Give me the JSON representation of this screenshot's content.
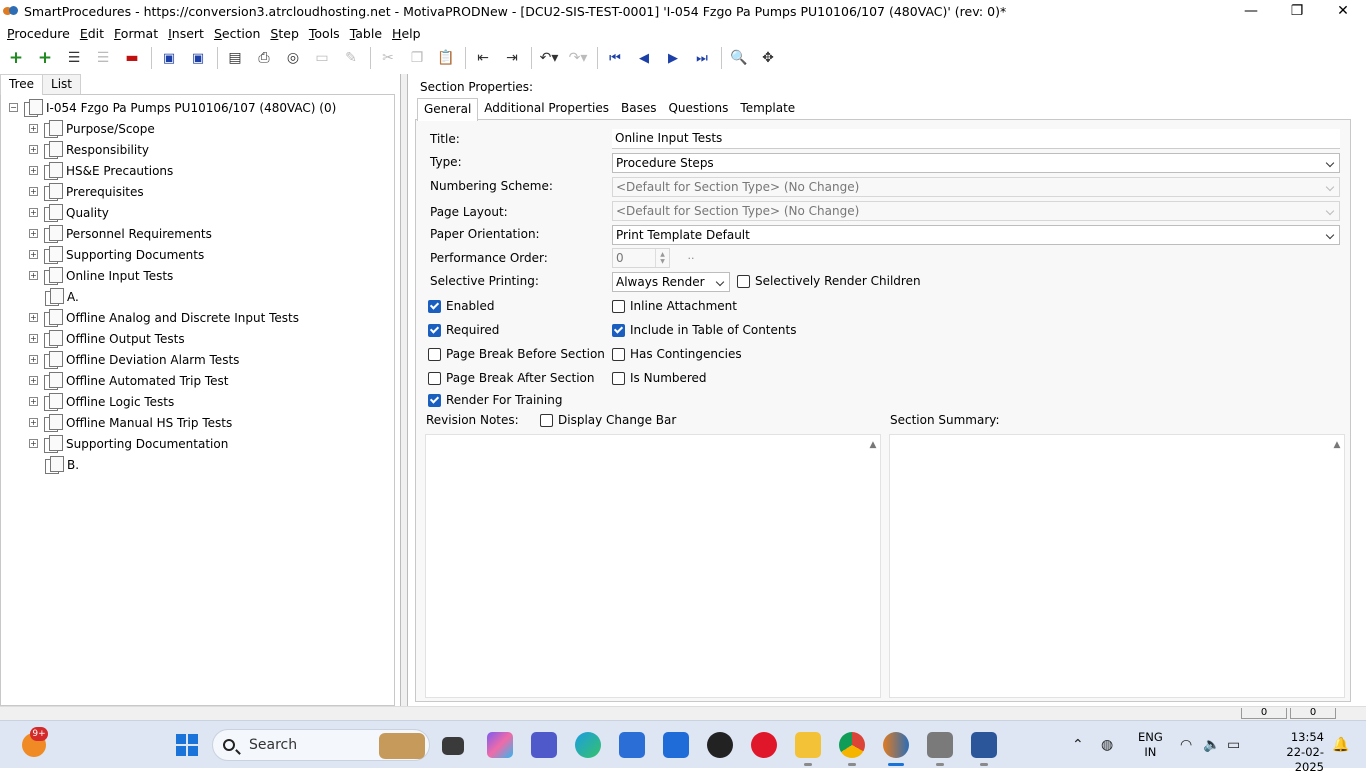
{
  "window": {
    "title": "SmartProcedures - https://conversion3.atrcloudhosting.net - MotivaPRODNew - [DCU2-SIS-TEST-0001] 'I-054 Fzgo Pa Pumps PU10106/107 (480VAC)' (rev: 0)*",
    "minimize": "—",
    "maximize": "❐",
    "close": "✕"
  },
  "menu": [
    "Procedure",
    "Edit",
    "Format",
    "Insert",
    "Section",
    "Step",
    "Tools",
    "Table",
    "Help"
  ],
  "left_pane": {
    "tabs": [
      "Tree",
      "List"
    ],
    "active_tab": "Tree",
    "root": {
      "label": "I-054 Fzgo Pa Pumps PU10106/107 (480VAC) (0)",
      "expander": "−"
    },
    "nodes": [
      {
        "label": "Purpose/Scope",
        "expander": "+"
      },
      {
        "label": "Responsibility",
        "expander": "+"
      },
      {
        "label": "HS&E Precautions",
        "expander": "+"
      },
      {
        "label": "Prerequisites",
        "expander": "+"
      },
      {
        "label": "Quality",
        "expander": "+"
      },
      {
        "label": "Personnel Requirements",
        "expander": "+"
      },
      {
        "label": "Supporting Documents",
        "expander": "+"
      },
      {
        "label": "Online Input Tests",
        "expander": "+"
      },
      {
        "label": "A.",
        "expander": ""
      },
      {
        "label": "Offline Analog and Discrete Input Tests",
        "expander": "+"
      },
      {
        "label": "Offline Output Tests",
        "expander": "+"
      },
      {
        "label": "Offline Deviation Alarm Tests",
        "expander": "+"
      },
      {
        "label": "Offline Automated Trip Test",
        "expander": "+"
      },
      {
        "label": "Offline Logic Tests",
        "expander": "+"
      },
      {
        "label": "Offline Manual HS Trip Tests",
        "expander": "+"
      },
      {
        "label": "Supporting Documentation",
        "expander": "+"
      },
      {
        "label": "B.",
        "expander": ""
      }
    ]
  },
  "section_properties": {
    "header": "Section Properties:",
    "tabs": [
      "General",
      "Additional Properties",
      "Bases",
      "Questions",
      "Template"
    ],
    "active_tab": "General",
    "fields": {
      "title_label": "Title:",
      "title_value": "Online Input Tests",
      "type_label": "Type:",
      "type_value": "Procedure Steps",
      "numbering_label": "Numbering Scheme:",
      "numbering_value": "<Default for Section Type> (No Change)",
      "layout_label": "Page Layout:",
      "layout_value": "<Default for Section Type> (No Change)",
      "orientation_label": "Paper Orientation:",
      "orientation_value": "Print Template Default",
      "perf_order_label": "Performance Order:",
      "perf_order_value": "0",
      "perf_order_button": "..",
      "selective_label": "Selective Printing:",
      "selective_value": "Always Render"
    },
    "checkboxes": {
      "selectively_render_children": {
        "label": "Selectively Render Children",
        "checked": false
      },
      "enabled": {
        "label": "Enabled",
        "checked": true
      },
      "inline_attachment": {
        "label": "Inline Attachment",
        "checked": false
      },
      "required": {
        "label": "Required",
        "checked": true
      },
      "include_toc": {
        "label": "Include in Table of Contents",
        "checked": true
      },
      "page_break_before": {
        "label": "Page Break Before Section",
        "checked": false
      },
      "has_contingencies": {
        "label": "Has Contingencies",
        "checked": false
      },
      "page_break_after": {
        "label": "Page Break After Section",
        "checked": false
      },
      "is_numbered": {
        "label": "Is Numbered",
        "checked": false
      },
      "render_for_training": {
        "label": "Render For Training",
        "checked": true
      },
      "display_change_bar": {
        "label": "Display Change Bar",
        "checked": false
      }
    },
    "revision_notes_label": "Revision Notes:",
    "section_summary_label": "Section Summary:"
  },
  "statusbar": {
    "left_count": "0",
    "right_count": "0"
  },
  "taskbar": {
    "notification_badge": "9+",
    "search_placeholder": "Search",
    "language": "ENG",
    "region": "IN",
    "time": "13:54",
    "date": "22-02-2025",
    "colors": {
      "accent": "#1a73d9"
    }
  }
}
